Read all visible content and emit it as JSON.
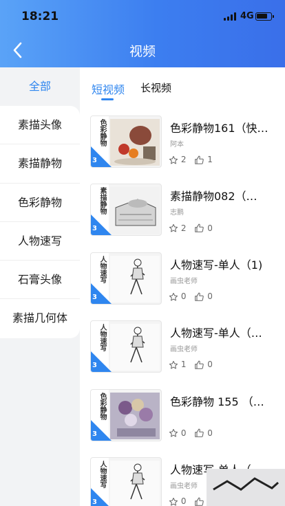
{
  "status_bar": {
    "time": "18:21",
    "network": "4G"
  },
  "header": {
    "title": "视频"
  },
  "sidebar": {
    "all_label": "全部",
    "items": [
      "素描头像",
      "素描静物",
      "色彩静物",
      "人物速写",
      "石膏头像",
      "素描几何体"
    ]
  },
  "tabs": {
    "short": "短视频",
    "long": "长视频"
  },
  "videos": [
    {
      "title": "色彩静物161（快…",
      "author": "阿本",
      "stars": "2",
      "likes": "1",
      "band": "色彩静物",
      "art": "color"
    },
    {
      "title": "素描静物082（…",
      "author": "志鹏",
      "stars": "2",
      "likes": "0",
      "band": "素描静物",
      "art": "sketch"
    },
    {
      "title": "人物速写-单人（1)",
      "author": "画虫老师",
      "stars": "0",
      "likes": "0",
      "band": "人物速写",
      "art": "figure"
    },
    {
      "title": "人物速写-单人（…",
      "author": "画虫老师",
      "stars": "1",
      "likes": "0",
      "band": "人物速写",
      "art": "figure"
    },
    {
      "title": "色彩静物 155 （…",
      "author": "",
      "stars": "0",
      "likes": "0",
      "band": "色彩静物",
      "art": "flowers"
    },
    {
      "title": "人物速写-单人（…",
      "author": "画虫老师",
      "stars": "0",
      "likes": "0",
      "band": "人物速写",
      "art": "figure"
    }
  ],
  "thumb_badge": "3",
  "colors": {
    "accent": "#2f86ef",
    "header_start": "#5aa3f7",
    "header_end": "#3a6fe9"
  }
}
